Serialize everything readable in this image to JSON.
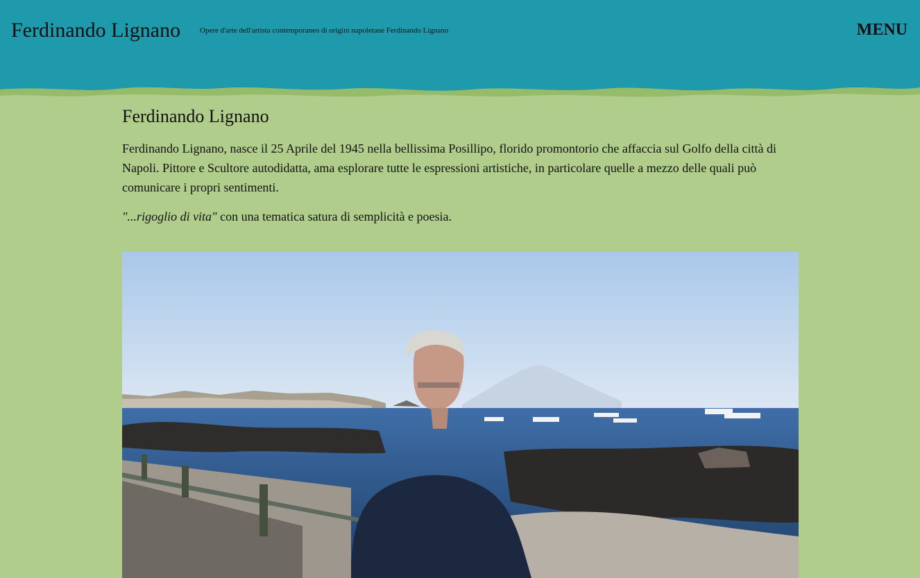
{
  "header": {
    "site_title": "Ferdinando Lignano",
    "tagline": "Opere d'arte dell'artista contemporaneo di origini napoletane Ferdinando Lignano",
    "menu_label": "MENU"
  },
  "main": {
    "title": "Ferdinando Lignano",
    "intro": "Ferdinando Lignano, nasce il 25 Aprile del 1945 nella bellissima Posillipo, florido promontorio che affaccia sul Golfo della città di Napoli. Pittore e Scultore autodidatta, ama esplorare tutte le espressioni artistiche, in particolare quelle a mezzo delle quali può comunicare i propri sentimenti.",
    "quote": "\"...rigoglio di vita\"",
    "quote_rest": " con una tematica satura di semplicità e poesia."
  },
  "colors": {
    "header_bg": "#1f9aad",
    "page_bg": "#b0cd8b",
    "text": "#111111"
  }
}
